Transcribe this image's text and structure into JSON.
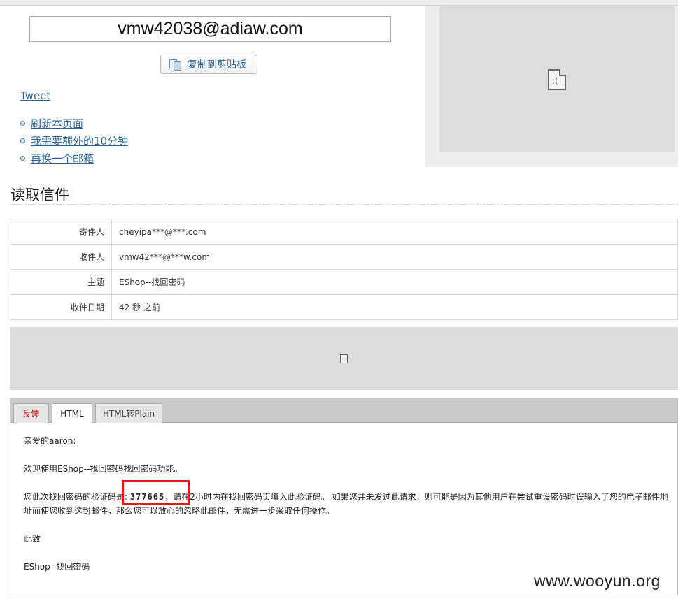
{
  "email": {
    "address": "vmw42038@adiaw.com",
    "copy_label": "复制到剪贴板"
  },
  "tweet_label": "Tweet",
  "actions": [
    {
      "label": "刷新本页面"
    },
    {
      "label": "我需要额外的10分钟"
    },
    {
      "label": "再换一个邮箱"
    }
  ],
  "section_title": "读取信件",
  "mail": {
    "rows": [
      {
        "key": "寄件人",
        "value": "cheyipa***@***.com"
      },
      {
        "key": "收件人",
        "value": "vmw42***@***w.com"
      },
      {
        "key": "主题",
        "value": "EShop--找回密码"
      },
      {
        "key": "收件日期",
        "value": "42 秒 之前"
      }
    ]
  },
  "tabs": {
    "feedback": "反馈",
    "html": "HTML",
    "plain": "HTML转Plain"
  },
  "body": {
    "greeting": "亲爱的aaron:",
    "welcome": "欢迎使用EShop--找回密码找回密码功能。",
    "code_prefix": "您此次找回密码的验证码是:",
    "code": "377665",
    "code_suffix": "，请在2小时内在找回密码页填入此验证码。 如果您并未发过此请求，则可能是因为其他用户在尝试重设密码时误输入了您的电子邮件地址而使您收到这封邮件，那么您可以放心的忽略此邮件，无需进一步采取任何操作。",
    "closing": "此致",
    "signature": "EShop--找回密码"
  },
  "watermark": "www.wooyun.org",
  "colors": {
    "link": "#2a6496",
    "highlight": "#e01b1b",
    "feedback_tab": "#c41010"
  }
}
